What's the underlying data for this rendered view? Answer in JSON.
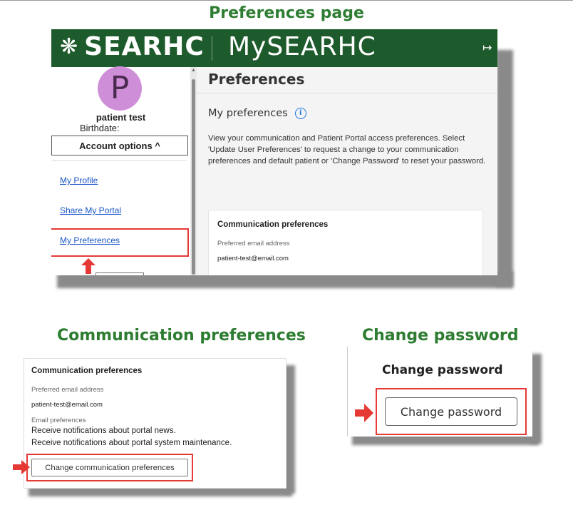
{
  "headings": {
    "main": "Preferences page",
    "comm": "Communication preferences",
    "password": "Change password"
  },
  "header": {
    "logo_text": "SEARHC",
    "app_name": "MySEARHC",
    "logout_icon": "logout-icon"
  },
  "sidebar": {
    "avatar_letter": "P",
    "patient_name": "patient test",
    "birthdate_label": "Birthdate:",
    "account_options_label": "Account options ^",
    "links": [
      "My Profile",
      "Share My Portal",
      "My Preferences"
    ],
    "highlighted_link": "My Preferences"
  },
  "content": {
    "title": "Preferences",
    "subheading": "My preferences",
    "description": "View your communication and Patient Portal access preferences. Select 'Update User Preferences' to request a change to your communication preferences and default patient or 'Change Password' to reset your password.",
    "card": {
      "title": "Communication preferences",
      "email_label": "Preferred email address",
      "email_value": "patient-test@email.com"
    }
  },
  "comm_panel": {
    "title": "Communication preferences",
    "email_label": "Preferred email address",
    "email_value": "patient-test@email.com",
    "email_prefs_label": "Email preferences",
    "lines": [
      "Receive notifications about portal news.",
      "Receive notifications about portal system maintenance."
    ],
    "button_label": "Change communication preferences"
  },
  "password_panel": {
    "title": "Change password",
    "button_label": "Change password"
  },
  "colors": {
    "heading_green": "#2e7d32",
    "header_green": "#1e5b2c",
    "highlight_red": "#e53935",
    "link_blue": "#1a56c7",
    "avatar_purple": "#cf8fd8"
  }
}
